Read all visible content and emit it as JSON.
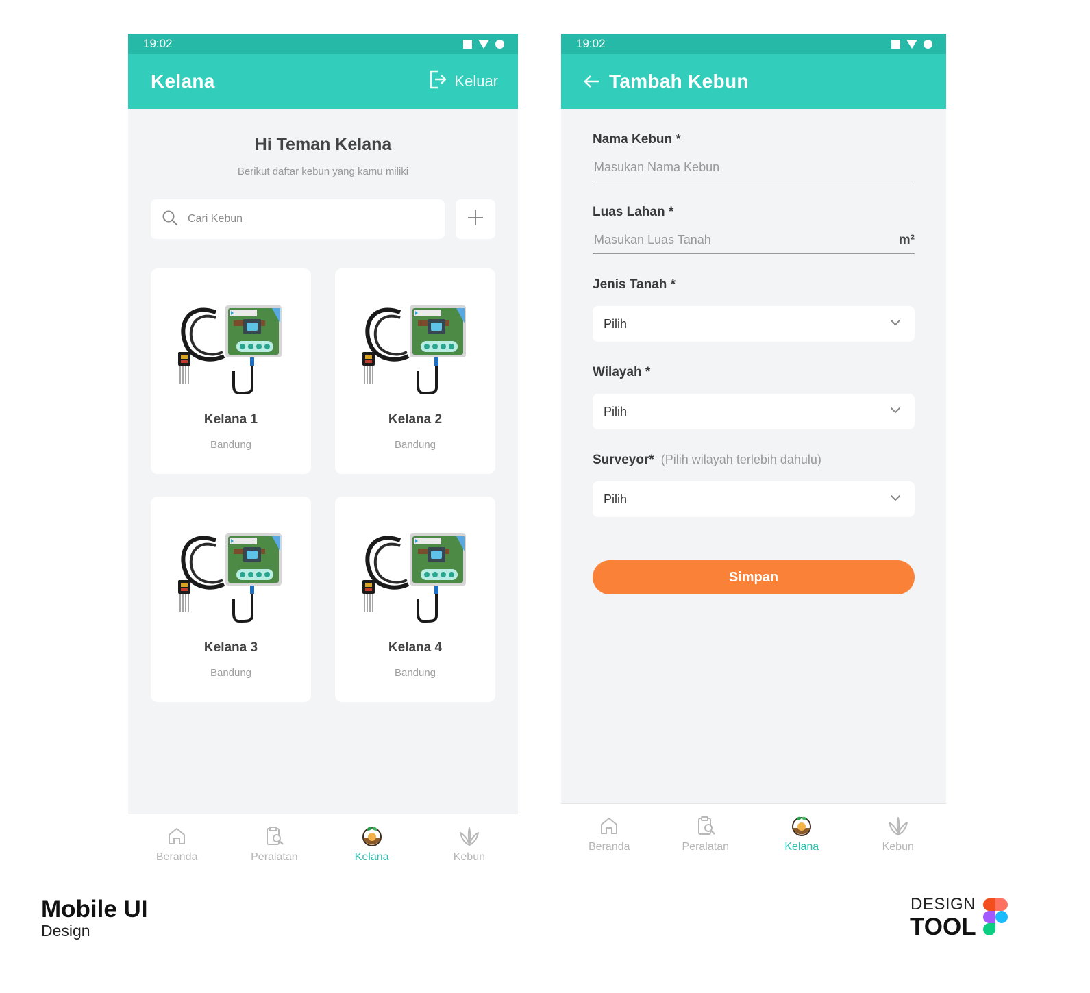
{
  "left_screen": {
    "status_time": "19:02",
    "app_title": "Kelana",
    "logout_label": "Keluar",
    "greeting": "Hi Teman Kelana",
    "subtitle": "Berikut daftar kebun yang kamu miliki",
    "search_placeholder": "Cari Kebun",
    "cards": [
      {
        "title": "Kelana 1",
        "location": "Bandung"
      },
      {
        "title": "Kelana 2",
        "location": "Bandung"
      },
      {
        "title": "Kelana 3",
        "location": "Bandung"
      },
      {
        "title": "Kelana 4",
        "location": "Bandung"
      }
    ]
  },
  "right_screen": {
    "status_time": "19:02",
    "app_title": "Tambah Kebun",
    "fields": {
      "nama_kebun": {
        "label": "Nama Kebun *",
        "placeholder": "Masukan Nama Kebun"
      },
      "luas_lahan": {
        "label": "Luas Lahan *",
        "placeholder": "Masukan Luas Tanah",
        "unit": "m²"
      },
      "jenis_tanah": {
        "label": "Jenis Tanah *",
        "value": "Pilih"
      },
      "wilayah": {
        "label": "Wilayah *",
        "value": "Pilih"
      },
      "surveyor": {
        "label": "Surveyor*",
        "hint": "(Pilih wilayah terlebih dahulu)",
        "value": "Pilih"
      }
    },
    "save_label": "Simpan"
  },
  "bottom_nav": {
    "items": [
      {
        "label": "Beranda",
        "icon": "home-icon"
      },
      {
        "label": "Peralatan",
        "icon": "clipboard-tools-icon"
      },
      {
        "label": "Kelana",
        "icon": "kelana-device-icon"
      },
      {
        "label": "Kebun",
        "icon": "leaf-icon"
      }
    ],
    "active": "Kelana"
  },
  "branding": {
    "title": "Mobile UI",
    "subtitle": "Design",
    "tool_top": "DESIGN",
    "tool_bottom": "TOOL"
  },
  "colors": {
    "status_bar": "#26b9a7",
    "app_bar": "#33cdbb",
    "accent": "#2bbfad",
    "save_button": "#f98138",
    "background": "#f3f4f6"
  }
}
